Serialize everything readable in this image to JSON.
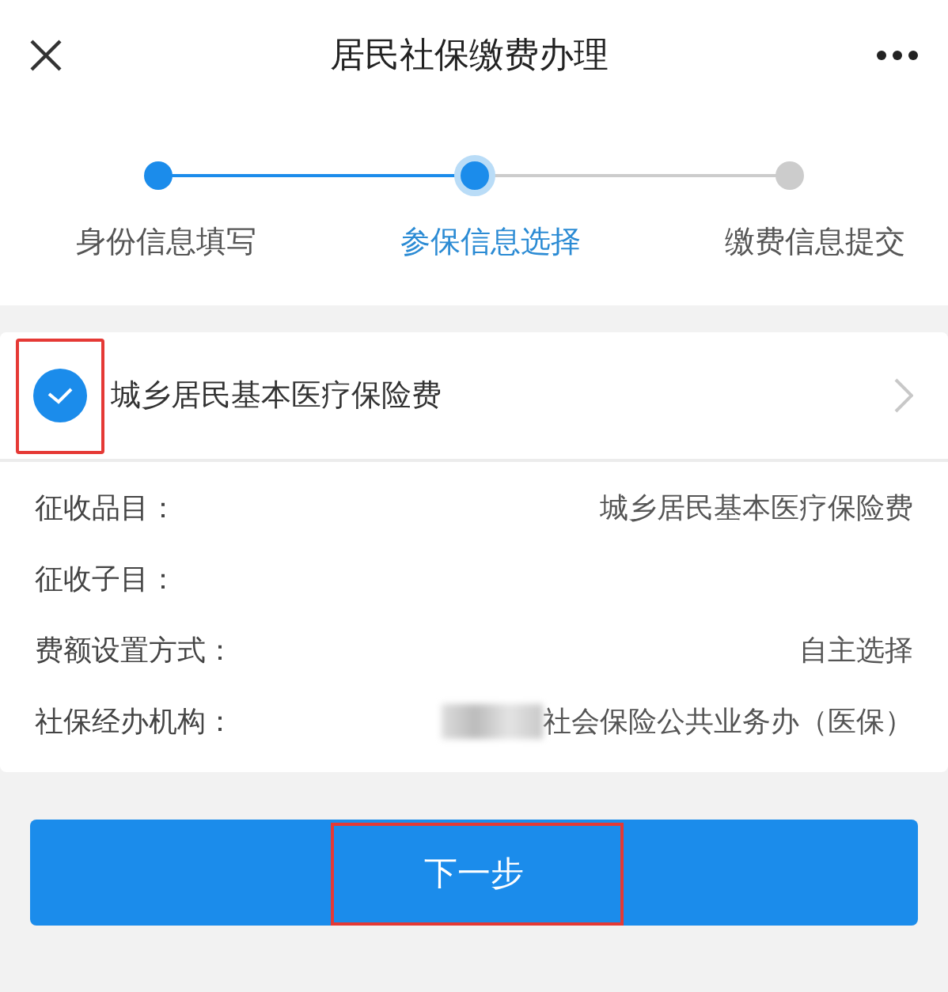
{
  "header": {
    "title": "居民社保缴费办理"
  },
  "steps": [
    {
      "label": "身份信息填写",
      "kind": "done"
    },
    {
      "label": "参保信息选择",
      "kind": "current"
    },
    {
      "label": "缴费信息提交",
      "kind": "todo"
    }
  ],
  "item": {
    "title": "城乡居民基本医疗保险费",
    "checked": true,
    "highlighted": true
  },
  "details": [
    {
      "label": "征收品目：",
      "value": "城乡居民基本医疗保险费",
      "redacted": false
    },
    {
      "label": "征收子目：",
      "redacted": false
    },
    {
      "label": "费额设置方式：",
      "value": "自主选择",
      "redacted": false
    },
    {
      "label": "社保经办机构：",
      "value": "社会保险公共业务办（医保）",
      "redacted": true
    }
  ],
  "button": {
    "label": "下一步",
    "highlighted": true
  }
}
